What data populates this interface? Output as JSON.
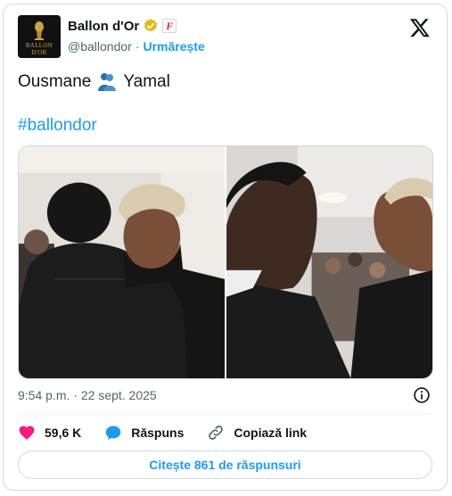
{
  "account": {
    "display_name": "Ballon d'Or",
    "handle": "@ballondor",
    "separator": "·",
    "follow_label": "Urmărește",
    "logo_text_line1": "BALLON",
    "logo_text_line2": "D'OR",
    "affiliate_badge_text": "F"
  },
  "post": {
    "text_word1": "Ousmane",
    "emoji": "people-hugging-emoji",
    "text_word2": "Yamal",
    "hashtag": "#ballondor",
    "time": "9:54 p.m.",
    "date_separator": "·",
    "date": "22 sept. 2025"
  },
  "actions": {
    "like_count": "59,6 K",
    "reply_label": "Răspuns",
    "copy_link_label": "Copiază link"
  },
  "read_replies_label": "Citește 861 de răspunsuri",
  "colors": {
    "accent": "#1d9bf0",
    "like": "#f91880",
    "verified": "#e2b719",
    "muted": "#536471"
  }
}
